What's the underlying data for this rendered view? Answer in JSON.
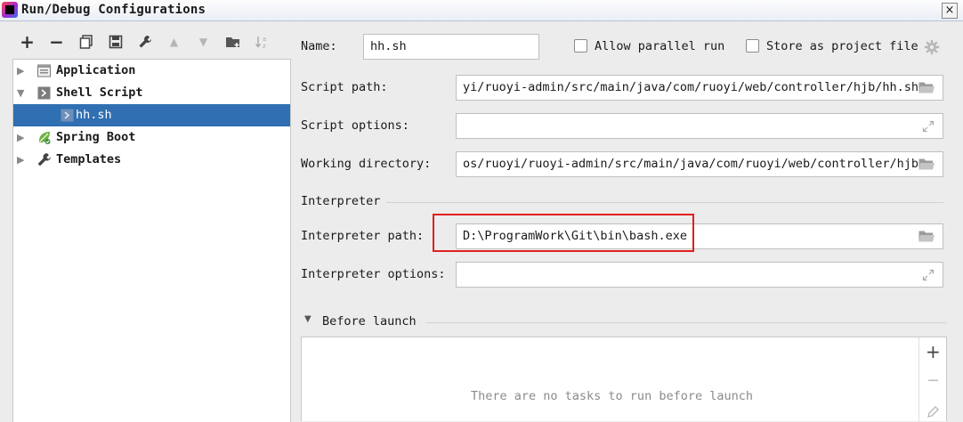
{
  "window": {
    "title": "Run/Debug Configurations",
    "close_glyph": "×"
  },
  "toolbar": {
    "buttons": [
      {
        "name": "add",
        "icon": "plus-icon",
        "glyph": "+"
      },
      {
        "name": "remove",
        "icon": "minus-icon",
        "glyph": "−"
      },
      {
        "name": "copy",
        "icon": "copy-icon"
      },
      {
        "name": "save",
        "icon": "save-icon"
      },
      {
        "name": "edit-defaults",
        "icon": "wrench-icon"
      },
      {
        "name": "move-up",
        "icon": "triangle-up-icon",
        "glyph": "▲"
      },
      {
        "name": "move-down",
        "icon": "triangle-down-icon",
        "glyph": "▼"
      },
      {
        "name": "new-folder",
        "icon": "folder-add-icon"
      },
      {
        "name": "sort",
        "icon": "sort-az-icon"
      }
    ]
  },
  "tree": {
    "items": [
      {
        "label": "Application",
        "expanded": false,
        "icon": "application-icon"
      },
      {
        "label": "Shell Script",
        "expanded": true,
        "icon": "shell-script-icon"
      },
      {
        "label": "hh.sh",
        "selected": true,
        "icon": "shell-script-icon"
      },
      {
        "label": "Spring Boot",
        "expanded": false,
        "icon": "spring-boot-icon"
      },
      {
        "label": "Templates",
        "expanded": false,
        "icon": "wrench-icon"
      }
    ]
  },
  "form": {
    "name_label": "Name:",
    "name_value": "hh.sh",
    "allow_parallel_label": "Allow parallel run",
    "allow_parallel_checked": false,
    "store_project_label": "Store as project file",
    "store_project_checked": false,
    "script_path_label": "Script path:",
    "script_path_value": "yi/ruoyi-admin/src/main/java/com/ruoyi/web/controller/hjb/hh.sh",
    "script_options_label": "Script options:",
    "script_options_value": "",
    "working_dir_label": "Working directory:",
    "working_dir_value": "os/ruoyi/ruoyi-admin/src/main/java/com/ruoyi/web/controller/hjb",
    "interpreter_section": "Interpreter",
    "interpreter_path_label": "Interpreter path:",
    "interpreter_path_value": "D:\\ProgramWork\\Git\\bin\\bash.exe",
    "interpreter_options_label": "Interpreter options:",
    "interpreter_options_value": ""
  },
  "before_launch": {
    "title": "Before launch",
    "empty_text": "There are no tasks to run before launch",
    "add_glyph": "+",
    "remove_glyph": "−"
  },
  "colors": {
    "selection": "#2f6fb2",
    "highlight_box": "#e02020"
  }
}
